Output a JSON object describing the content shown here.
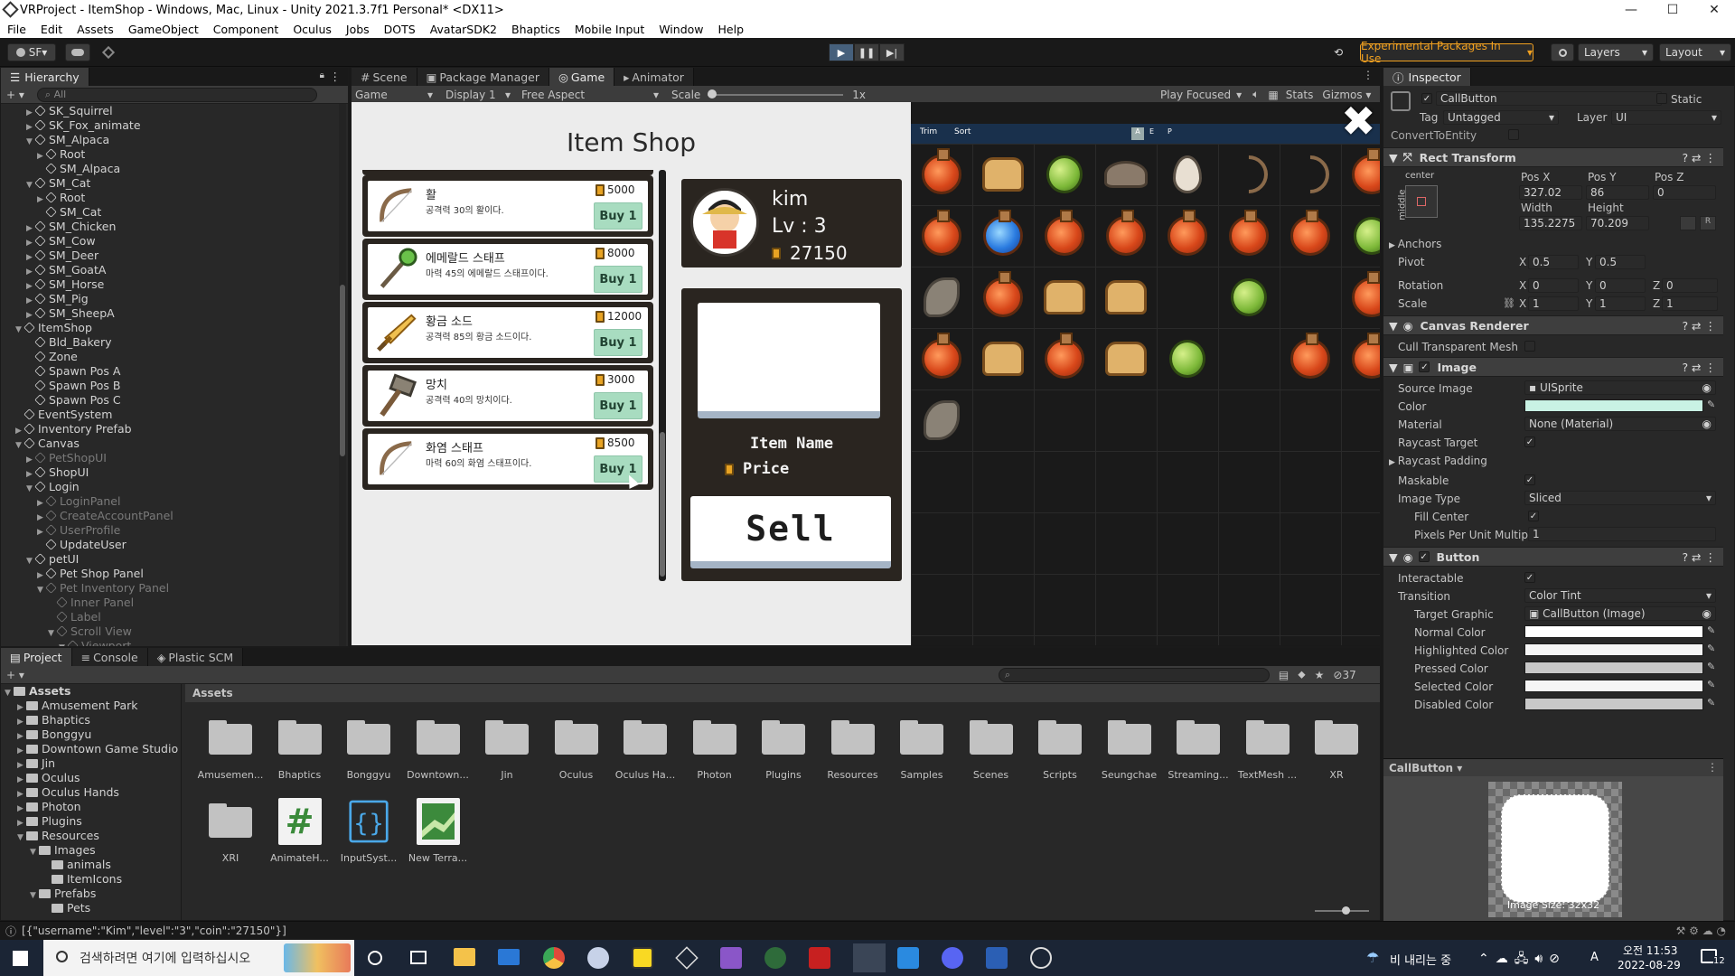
{
  "window": {
    "title": "VRProject - ItemShop - Windows, Mac, Linux - Unity 2021.3.7f1 Personal* <DX11>",
    "minimize": "—",
    "maximize": "☐",
    "close": "✕"
  },
  "menu": [
    "File",
    "Edit",
    "Assets",
    "GameObject",
    "Component",
    "Oculus",
    "Jobs",
    "DOTS",
    "AvatarSDK2",
    "Bhaptics",
    "Mobile Input",
    "Window",
    "Help"
  ],
  "toolbar": {
    "account": "SF",
    "experimental": "Experimental Packages In Use",
    "layers": "Layers",
    "layout": "Layout"
  },
  "hierarchy": {
    "tab": "Hierarchy",
    "search_placeholder": "All",
    "items": [
      {
        "label": "SK_Squirrel",
        "depth": 2,
        "arrow": "▶",
        "dim": false
      },
      {
        "label": "SK_Fox_animate",
        "depth": 2,
        "arrow": "▶",
        "dim": false
      },
      {
        "label": "SM_Alpaca",
        "depth": 2,
        "arrow": "▼",
        "dim": false
      },
      {
        "label": "Root",
        "depth": 3,
        "arrow": "▶",
        "dim": false
      },
      {
        "label": "SM_Alpaca",
        "depth": 3,
        "arrow": "",
        "dim": false
      },
      {
        "label": "SM_Cat",
        "depth": 2,
        "arrow": "▼",
        "dim": false
      },
      {
        "label": "Root",
        "depth": 3,
        "arrow": "▶",
        "dim": false
      },
      {
        "label": "SM_Cat",
        "depth": 3,
        "arrow": "",
        "dim": false
      },
      {
        "label": "SM_Chicken",
        "depth": 2,
        "arrow": "▶",
        "dim": false
      },
      {
        "label": "SM_Cow",
        "depth": 2,
        "arrow": "▶",
        "dim": false
      },
      {
        "label": "SM_Deer",
        "depth": 2,
        "arrow": "▶",
        "dim": false
      },
      {
        "label": "SM_GoatA",
        "depth": 2,
        "arrow": "▶",
        "dim": false
      },
      {
        "label": "SM_Horse",
        "depth": 2,
        "arrow": "▶",
        "dim": false
      },
      {
        "label": "SM_Pig",
        "depth": 2,
        "arrow": "▶",
        "dim": false
      },
      {
        "label": "SM_SheepA",
        "depth": 2,
        "arrow": "▶",
        "dim": false
      },
      {
        "label": "ItemShop",
        "depth": 1,
        "arrow": "▼",
        "dim": false
      },
      {
        "label": "Bld_Bakery",
        "depth": 2,
        "arrow": "",
        "dim": false
      },
      {
        "label": "Zone",
        "depth": 2,
        "arrow": "",
        "dim": false
      },
      {
        "label": "Spawn Pos A",
        "depth": 2,
        "arrow": "",
        "dim": false
      },
      {
        "label": "Spawn Pos B",
        "depth": 2,
        "arrow": "",
        "dim": false
      },
      {
        "label": "Spawn Pos C",
        "depth": 2,
        "arrow": "",
        "dim": false
      },
      {
        "label": "EventSystem",
        "depth": 1,
        "arrow": "",
        "dim": false
      },
      {
        "label": "Inventory Prefab",
        "depth": 1,
        "arrow": "▶",
        "dim": false
      },
      {
        "label": "Canvas",
        "depth": 1,
        "arrow": "▼",
        "dim": false
      },
      {
        "label": "PetShopUI",
        "depth": 2,
        "arrow": "▶",
        "dim": true
      },
      {
        "label": "ShopUI",
        "depth": 2,
        "arrow": "▶",
        "dim": false
      },
      {
        "label": "Login",
        "depth": 2,
        "arrow": "▼",
        "dim": false
      },
      {
        "label": "LoginPanel",
        "depth": 3,
        "arrow": "▶",
        "dim": true
      },
      {
        "label": "CreateAccountPanel",
        "depth": 3,
        "arrow": "▶",
        "dim": true
      },
      {
        "label": "UserProfile",
        "depth": 3,
        "arrow": "▶",
        "dim": true
      },
      {
        "label": "UpdateUser",
        "depth": 3,
        "arrow": "",
        "dim": false
      },
      {
        "label": "petUI",
        "depth": 2,
        "arrow": "▼",
        "dim": false
      },
      {
        "label": "Pet Shop Panel",
        "depth": 3,
        "arrow": "▶",
        "dim": false
      },
      {
        "label": "Pet Inventory Panel",
        "depth": 3,
        "arrow": "▼",
        "dim": true
      },
      {
        "label": "Inner Panel",
        "depth": 4,
        "arrow": "",
        "dim": true
      },
      {
        "label": "Label",
        "depth": 4,
        "arrow": "",
        "dim": true
      },
      {
        "label": "Scroll View",
        "depth": 4,
        "arrow": "▼",
        "dim": true
      },
      {
        "label": "Viewport",
        "depth": 5,
        "arrow": "▼",
        "dim": true
      }
    ]
  },
  "view_tabs": [
    "Scene",
    "Package Manager",
    "Game",
    "Animator"
  ],
  "game_bar": {
    "mode": "Game",
    "display": "Display 1",
    "aspect": "Free Aspect",
    "scale_label": "Scale",
    "scale_value": "1x",
    "play_focused": "Play Focused",
    "stats": "Stats",
    "gizmos": "Gizmos"
  },
  "shop": {
    "title": "Item Shop",
    "buy_label": "Buy 1",
    "items": [
      {
        "name": "활",
        "desc": "공격력 30의 활이다.",
        "price": "5000",
        "icon": "bow"
      },
      {
        "name": "에메랄드 스태프",
        "desc": "마력 45의 에메랄드 스태프이다.",
        "price": "8000",
        "icon": "emerald-staff"
      },
      {
        "name": "황금 소드",
        "desc": "공격력 85의 황금 소드이다.",
        "price": "12000",
        "icon": "golden-sword"
      },
      {
        "name": "망치",
        "desc": "공격력 40의 망치이다.",
        "price": "3000",
        "icon": "hammer"
      },
      {
        "name": "화염 스태프",
        "desc": "마력 60의 화염 스태프이다.",
        "price": "8500",
        "icon": "flame-staff"
      }
    ],
    "profile": {
      "name": "kim",
      "level": "Lv : 3",
      "coins": "27150"
    },
    "sell": {
      "item_name": "Item Name",
      "price": "Price",
      "button": "Sell"
    },
    "inventory": {
      "tabs": [
        "Trim",
        "Sort"
      ],
      "filters": [
        "A",
        "E",
        "P"
      ],
      "close_icon": "✖",
      "grid": [
        [
          "potion-red",
          "bread",
          "apple",
          "hat",
          "egg",
          "bow",
          "bow",
          "potion-red"
        ],
        [
          "potion-red",
          "potion-blue",
          "potion-red",
          "potion-red",
          "potion-red",
          "potion-red",
          "potion-red",
          "apple"
        ],
        [
          "feather",
          "potion-red",
          "bread",
          "bread",
          "",
          "apple",
          "",
          "potion-red"
        ],
        [
          "potion-red",
          "bread",
          "potion-red",
          "bread",
          "apple",
          "",
          "potion-red",
          "potion-red"
        ],
        [
          "feather",
          "",
          "",
          "",
          "",
          "",
          "",
          ""
        ]
      ]
    }
  },
  "inspector": {
    "tab": "Inspector",
    "object_name": "CallButton",
    "static": "Static",
    "tag_label": "Tag",
    "tag_value": "Untagged",
    "layer_label": "Layer",
    "layer_value": "UI",
    "convert": "ConvertToEntity",
    "rect_transform": {
      "title": "Rect Transform",
      "anchor_h": "center",
      "anchor_v": "middle",
      "posx_label": "Pos X",
      "posx": "327.02",
      "posy_label": "Pos Y",
      "posy": "86",
      "posz_label": "Pos Z",
      "posz": "0",
      "width_label": "Width",
      "width": "135.2275",
      "height_label": "Height",
      "height": "70.209",
      "anchors": "Anchors",
      "pivot_label": "Pivot",
      "pivot_x": "0.5",
      "pivot_y": "0.5",
      "rotation_label": "Rotation",
      "rot_x": "0",
      "rot_y": "0",
      "rot_z": "0",
      "scale_label": "Scale",
      "scale_x": "1",
      "scale_y": "1",
      "scale_z": "1"
    },
    "canvas_renderer": {
      "title": "Canvas Renderer",
      "cull": "Cull Transparent Mesh"
    },
    "image": {
      "title": "Image",
      "source_label": "Source Image",
      "source": "UISprite",
      "color_label": "Color",
      "color": "#c9f2e4",
      "material_label": "Material",
      "material": "None (Material)",
      "raycast_target": "Raycast Target",
      "raycast_padding": "Raycast Padding",
      "maskable": "Maskable",
      "type_label": "Image Type",
      "type": "Sliced",
      "fill_center": "Fill Center",
      "ppu_label": "Pixels Per Unit Multipl",
      "ppu": "1"
    },
    "button": {
      "title": "Button",
      "interactable": "Interactable",
      "transition_label": "Transition",
      "transition": "Color Tint",
      "target_label": "Target Graphic",
      "target": "CallButton (Image)",
      "colors": [
        {
          "label": "Normal Color",
          "hex": "#ffffff"
        },
        {
          "label": "Highlighted Color",
          "hex": "#f5f5f5"
        },
        {
          "label": "Pressed Color",
          "hex": "#c8c8c8"
        },
        {
          "label": "Selected Color",
          "hex": "#f5f5f5"
        },
        {
          "label": "Disabled Color",
          "hex": "#c8c8c8"
        }
      ]
    },
    "preview": {
      "title": "CallButton",
      "caption": "CallButton",
      "size": "Image Size: 32x32"
    }
  },
  "project": {
    "tabs": [
      "Project",
      "Console",
      "Plastic SCM"
    ],
    "breadcrumb": "Assets",
    "count": "37",
    "tree": [
      {
        "label": "Assets",
        "depth": 0,
        "arrow": "▼",
        "bold": true
      },
      {
        "label": "Amusement Park",
        "depth": 1,
        "arrow": "▶"
      },
      {
        "label": "Bhaptics",
        "depth": 1,
        "arrow": "▶"
      },
      {
        "label": "Bonggyu",
        "depth": 1,
        "arrow": "▶"
      },
      {
        "label": "Downtown Game Studio",
        "depth": 1,
        "arrow": "▶"
      },
      {
        "label": "Jin",
        "depth": 1,
        "arrow": "▶"
      },
      {
        "label": "Oculus",
        "depth": 1,
        "arrow": "▶"
      },
      {
        "label": "Oculus Hands",
        "depth": 1,
        "arrow": "▶"
      },
      {
        "label": "Photon",
        "depth": 1,
        "arrow": "▶"
      },
      {
        "label": "Plugins",
        "depth": 1,
        "arrow": "▶"
      },
      {
        "label": "Resources",
        "depth": 1,
        "arrow": "▼"
      },
      {
        "label": "Images",
        "depth": 2,
        "arrow": "▼"
      },
      {
        "label": "animals",
        "depth": 3,
        "arrow": ""
      },
      {
        "label": "ItemIcons",
        "depth": 3,
        "arrow": ""
      },
      {
        "label": "Prefabs",
        "depth": 2,
        "arrow": "▼"
      },
      {
        "label": "Pets",
        "depth": 3,
        "arrow": ""
      }
    ],
    "assets": [
      {
        "label": "Amusemen...",
        "type": "folder"
      },
      {
        "label": "Bhaptics",
        "type": "folder"
      },
      {
        "label": "Bonggyu",
        "type": "folder"
      },
      {
        "label": "Downtown...",
        "type": "folder"
      },
      {
        "label": "Jin",
        "type": "folder"
      },
      {
        "label": "Oculus",
        "type": "folder"
      },
      {
        "label": "Oculus Ha...",
        "type": "folder"
      },
      {
        "label": "Photon",
        "type": "folder"
      },
      {
        "label": "Plugins",
        "type": "folder"
      },
      {
        "label": "Resources",
        "type": "folder"
      },
      {
        "label": "Samples",
        "type": "folder"
      },
      {
        "label": "Scenes",
        "type": "folder"
      },
      {
        "label": "Scripts",
        "type": "folder"
      },
      {
        "label": "Seungchae",
        "type": "folder"
      },
      {
        "label": "Streaming...",
        "type": "folder"
      },
      {
        "label": "TextMesh ...",
        "type": "folder"
      },
      {
        "label": "XR",
        "type": "folder"
      },
      {
        "label": "XRI",
        "type": "folder"
      },
      {
        "label": "AnimateH...",
        "type": "script"
      },
      {
        "label": "InputSyst...",
        "type": "input"
      },
      {
        "label": "New Terra...",
        "type": "terrain"
      }
    ]
  },
  "status": {
    "message": "[{\"username\":\"Kim\",\"level\":\"3\",\"coin\":\"27150\"}]"
  },
  "taskbar": {
    "search": "검색하려면 여기에 입력하십시오",
    "weather": "비 내리는 중",
    "ime": "A",
    "time_top": "오전 11:53",
    "date": "2022-08-29",
    "notif": "12"
  }
}
